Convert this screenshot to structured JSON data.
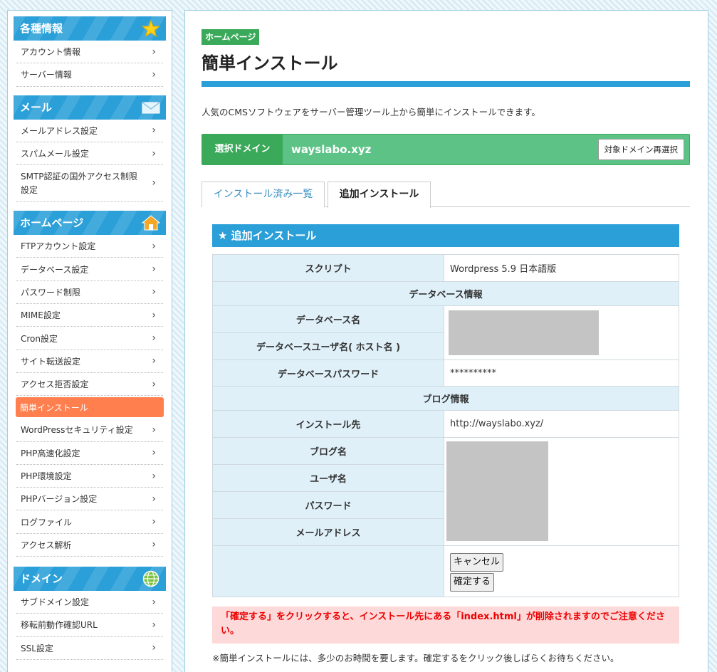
{
  "sidebar": {
    "sections": [
      {
        "title": "各種情報",
        "icon": "star-icon",
        "items": [
          "アカウント情報",
          "サーバー情報"
        ]
      },
      {
        "title": "メール",
        "icon": "mail-icon",
        "items": [
          "メールアドレス設定",
          "スパムメール設定",
          "SMTP認証の国外アクセス制限設定"
        ]
      },
      {
        "title": "ホームページ",
        "icon": "house-icon",
        "active": "簡単インストール",
        "items": [
          "FTPアカウント設定",
          "データベース設定",
          "パスワード制限",
          "MIME設定",
          "Cron設定",
          "サイト転送設定",
          "アクセス拒否設定",
          "簡単インストール",
          "WordPressセキュリティ設定",
          "PHP高速化設定",
          "PHP環境設定",
          "PHPバージョン設定",
          "ログファイル",
          "アクセス解析"
        ]
      },
      {
        "title": "ドメイン",
        "icon": "globe-icon",
        "items": [
          "サブドメイン設定",
          "移転前動作確認URL",
          "SSL設定"
        ]
      }
    ]
  },
  "main": {
    "badge": "ホームページ",
    "title": "簡単インストール",
    "intro": "人気のCMSソフトウェアをサーバー管理ツール上から簡単にインストールできます。",
    "domain": {
      "label": "選択ドメイン",
      "value": "wayslabo.xyz",
      "reselect_label": "対象ドメイン再選択"
    },
    "tabs": [
      {
        "label": "インストール済み一覧",
        "active": false
      },
      {
        "label": "追加インストール",
        "active": true
      }
    ],
    "panel_title": "追加インストール",
    "form": {
      "script_label": "スクリプト",
      "script_value": "Wordpress 5.9 日本語版",
      "db_section": "データベース情報",
      "db_name_label": "データベース名",
      "db_user_label": "データベースユーザ名( ホスト名 )",
      "db_pass_label": "データベースパスワード",
      "db_pass_value": "**********",
      "blog_section": "ブログ情報",
      "install_to_label": "インストール先",
      "install_to_value": "http://wayslabo.xyz/",
      "blog_name_label": "ブログ名",
      "user_label": "ユーザ名",
      "password_label": "パスワード",
      "email_label": "メールアドレス",
      "cancel_label": "キャンセル",
      "confirm_label": "確定する"
    },
    "warning": "「確定する」をクリックすると、インストール先にある「index.html」が削除されますのでご注意ください。",
    "note": "※簡単インストールには、多少のお時間を要します。確定するをクリック後しばらくお待ちください。"
  },
  "colors": {
    "accent": "#2a9fd8",
    "green": "#3aaa5a",
    "active_menu": "#ff7f4e",
    "warning_bg": "#fdd9d9",
    "warning_text": "#ee0000"
  }
}
